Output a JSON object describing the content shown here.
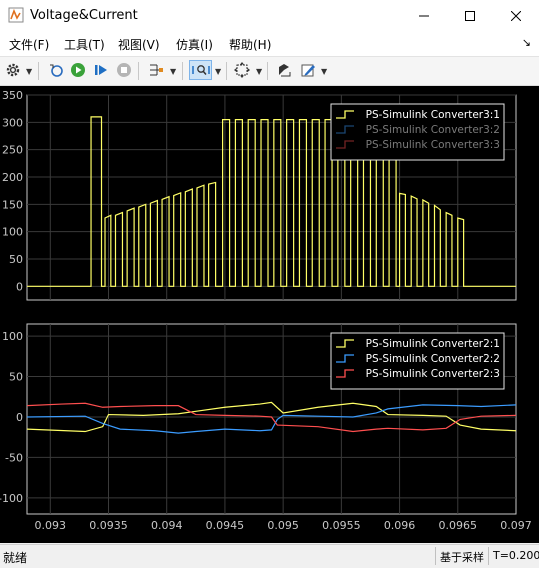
{
  "window": {
    "title": "Voltage&Current"
  },
  "menu": [
    "文件(F)",
    "工具(T)",
    "视图(V)",
    "仿真(I)",
    "帮助(H)"
  ],
  "toolbar": {
    "icons": [
      "gear-icon",
      "open-file-icon",
      "run-icon",
      "step-forward-icon",
      "stop-icon",
      "signal-selector-icon",
      "zoom-box-icon",
      "fit-to-view-icon",
      "write-data-icon",
      "style-edit-icon"
    ]
  },
  "status": {
    "left": "就绪",
    "mode": "基于采样",
    "time": "T=0.200"
  },
  "colors": {
    "series1": "#ffff66",
    "series2": "#3b9cff",
    "series3": "#ff4f4f",
    "plot_bg": "#000000",
    "axis": "#c8c8c8"
  },
  "chart_data": [
    {
      "type": "line",
      "xlim": [
        0.0928,
        0.097
      ],
      "ylim": [
        -25,
        350
      ],
      "yticks": [
        0,
        50,
        100,
        150,
        200,
        250,
        300,
        350
      ],
      "grid": true,
      "legend_position": "top-right",
      "series": [
        {
          "name": "PS-Simulink Converter3:1",
          "color": "#ffff66",
          "active": true,
          "points": [
            [
              0.0928,
              0
            ],
            [
              0.09335,
              0
            ],
            [
              0.09335,
              310
            ],
            [
              0.09344,
              310
            ],
            [
              0.09344,
              0
            ],
            [
              0.09347,
              0
            ],
            [
              0.09347,
              125
            ],
            [
              0.09352,
              130
            ],
            [
              0.09352,
              0
            ],
            [
              0.09356,
              0
            ],
            [
              0.09356,
              130
            ],
            [
              0.09362,
              135
            ],
            [
              0.09362,
              0
            ],
            [
              0.09366,
              0
            ],
            [
              0.09366,
              138
            ],
            [
              0.09372,
              143
            ],
            [
              0.09372,
              0
            ],
            [
              0.09376,
              0
            ],
            [
              0.09376,
              145
            ],
            [
              0.09382,
              150
            ],
            [
              0.09382,
              0
            ],
            [
              0.09386,
              0
            ],
            [
              0.09386,
              152
            ],
            [
              0.09392,
              157
            ],
            [
              0.09392,
              0
            ],
            [
              0.09396,
              0
            ],
            [
              0.09396,
              159
            ],
            [
              0.09402,
              164
            ],
            [
              0.09402,
              0
            ],
            [
              0.09406,
              0
            ],
            [
              0.09406,
              166
            ],
            [
              0.09412,
              171
            ],
            [
              0.09412,
              0
            ],
            [
              0.09416,
              0
            ],
            [
              0.09416,
              173
            ],
            [
              0.09422,
              178
            ],
            [
              0.09422,
              0
            ],
            [
              0.09426,
              0
            ],
            [
              0.09426,
              180
            ],
            [
              0.09432,
              185
            ],
            [
              0.09432,
              0
            ],
            [
              0.09436,
              0
            ],
            [
              0.09436,
              187
            ],
            [
              0.09442,
              190
            ],
            [
              0.09442,
              0
            ],
            [
              0.09448,
              0
            ],
            [
              0.09448,
              305
            ],
            [
              0.09454,
              305
            ],
            [
              0.09454,
              0
            ],
            [
              0.09459,
              0
            ],
            [
              0.09459,
              305
            ],
            [
              0.09465,
              305
            ],
            [
              0.09465,
              0
            ],
            [
              0.0947,
              0
            ],
            [
              0.0947,
              305
            ],
            [
              0.09476,
              305
            ],
            [
              0.09476,
              0
            ],
            [
              0.09481,
              0
            ],
            [
              0.09481,
              305
            ],
            [
              0.09487,
              305
            ],
            [
              0.09487,
              0
            ],
            [
              0.09492,
              0
            ],
            [
              0.09492,
              305
            ],
            [
              0.09498,
              305
            ],
            [
              0.09498,
              0
            ],
            [
              0.09503,
              0
            ],
            [
              0.09503,
              305
            ],
            [
              0.09509,
              305
            ],
            [
              0.09509,
              0
            ],
            [
              0.09514,
              0
            ],
            [
              0.09514,
              305
            ],
            [
              0.0952,
              305
            ],
            [
              0.0952,
              0
            ],
            [
              0.09525,
              0
            ],
            [
              0.09525,
              305
            ],
            [
              0.09531,
              305
            ],
            [
              0.09531,
              0
            ],
            [
              0.09536,
              0
            ],
            [
              0.09536,
              305
            ],
            [
              0.09542,
              305
            ],
            [
              0.09542,
              0
            ],
            [
              0.09547,
              0
            ],
            [
              0.09547,
              305
            ],
            [
              0.09553,
              305
            ],
            [
              0.09553,
              0
            ],
            [
              0.09558,
              0
            ],
            [
              0.09558,
              305
            ],
            [
              0.09564,
              305
            ],
            [
              0.09564,
              0
            ],
            [
              0.09569,
              0
            ],
            [
              0.09569,
              305
            ],
            [
              0.09575,
              305
            ],
            [
              0.09575,
              0
            ],
            [
              0.0958,
              0
            ],
            [
              0.0958,
              305
            ],
            [
              0.09586,
              305
            ],
            [
              0.09586,
              0
            ],
            [
              0.09591,
              0
            ],
            [
              0.09591,
              305
            ],
            [
              0.09597,
              305
            ],
            [
              0.09597,
              0
            ],
            [
              0.096,
              0
            ],
            [
              0.096,
              170
            ],
            [
              0.09605,
              168
            ],
            [
              0.09605,
              0
            ],
            [
              0.0961,
              0
            ],
            [
              0.0961,
              165
            ],
            [
              0.09615,
              160
            ],
            [
              0.09615,
              0
            ],
            [
              0.0962,
              0
            ],
            [
              0.0962,
              158
            ],
            [
              0.09625,
              152
            ],
            [
              0.09625,
              0
            ],
            [
              0.0963,
              0
            ],
            [
              0.0963,
              148
            ],
            [
              0.09635,
              140
            ],
            [
              0.09635,
              0
            ],
            [
              0.0964,
              0
            ],
            [
              0.0964,
              135
            ],
            [
              0.09645,
              130
            ],
            [
              0.09645,
              0
            ],
            [
              0.0965,
              0
            ],
            [
              0.0965,
              125
            ],
            [
              0.09655,
              122
            ],
            [
              0.09655,
              0
            ],
            [
              0.097,
              0
            ]
          ]
        },
        {
          "name": "PS-Simulink Converter3:2",
          "color": "#3b9cff",
          "active": false,
          "points": []
        },
        {
          "name": "PS-Simulink Converter3:3",
          "color": "#ff4f4f",
          "active": false,
          "points": []
        }
      ]
    },
    {
      "type": "line",
      "xlim": [
        0.0928,
        0.097
      ],
      "ylim": [
        -120,
        115
      ],
      "yticks": [
        -100,
        -50,
        0,
        50,
        100
      ],
      "xticks": [
        "0.093",
        "0.0935",
        "0.094",
        "0.0945",
        "0.095",
        "0.0955",
        "0.096",
        "0.0965",
        "0.097"
      ],
      "grid": true,
      "legend_position": "top-right",
      "series": [
        {
          "name": "PS-Simulink Converter2:1",
          "color": "#ffff66",
          "points": [
            [
              0.0928,
              -15
            ],
            [
              0.0933,
              -18
            ],
            [
              0.09345,
              -12
            ],
            [
              0.0935,
              3
            ],
            [
              0.0938,
              2
            ],
            [
              0.0941,
              4
            ],
            [
              0.09425,
              7
            ],
            [
              0.0945,
              12
            ],
            [
              0.0948,
              16
            ],
            [
              0.0949,
              18
            ],
            [
              0.095,
              5
            ],
            [
              0.0953,
              12
            ],
            [
              0.0956,
              17
            ],
            [
              0.0958,
              13
            ],
            [
              0.0959,
              3
            ],
            [
              0.0962,
              2
            ],
            [
              0.0964,
              1
            ],
            [
              0.09652,
              -10
            ],
            [
              0.0967,
              -15
            ],
            [
              0.097,
              -17
            ]
          ]
        },
        {
          "name": "PS-Simulink Converter2:2",
          "color": "#3b9cff",
          "points": [
            [
              0.0928,
              0
            ],
            [
              0.0933,
              1
            ],
            [
              0.09345,
              -8
            ],
            [
              0.0936,
              -15
            ],
            [
              0.0939,
              -17
            ],
            [
              0.0941,
              -20
            ],
            [
              0.09425,
              -18
            ],
            [
              0.0945,
              -15
            ],
            [
              0.0948,
              -17
            ],
            [
              0.0949,
              -16
            ],
            [
              0.09495,
              -3
            ],
            [
              0.095,
              2
            ],
            [
              0.0953,
              1
            ],
            [
              0.0956,
              0
            ],
            [
              0.0958,
              5
            ],
            [
              0.0959,
              10
            ],
            [
              0.0962,
              15
            ],
            [
              0.0965,
              14
            ],
            [
              0.0967,
              13
            ],
            [
              0.097,
              15
            ]
          ]
        },
        {
          "name": "PS-Simulink Converter2:3",
          "color": "#ff4f4f",
          "points": [
            [
              0.0928,
              14
            ],
            [
              0.0931,
              16
            ],
            [
              0.0933,
              17
            ],
            [
              0.09345,
              12
            ],
            [
              0.0936,
              13
            ],
            [
              0.0939,
              14
            ],
            [
              0.0941,
              14
            ],
            [
              0.09425,
              3
            ],
            [
              0.0945,
              2
            ],
            [
              0.0948,
              1
            ],
            [
              0.0949,
              0
            ],
            [
              0.09495,
              -10
            ],
            [
              0.0953,
              -12
            ],
            [
              0.0956,
              -18
            ],
            [
              0.0958,
              -15
            ],
            [
              0.0959,
              -14
            ],
            [
              0.0962,
              -16
            ],
            [
              0.0964,
              -14
            ],
            [
              0.09652,
              -3
            ],
            [
              0.0967,
              1
            ],
            [
              0.097,
              2
            ]
          ]
        }
      ]
    }
  ]
}
